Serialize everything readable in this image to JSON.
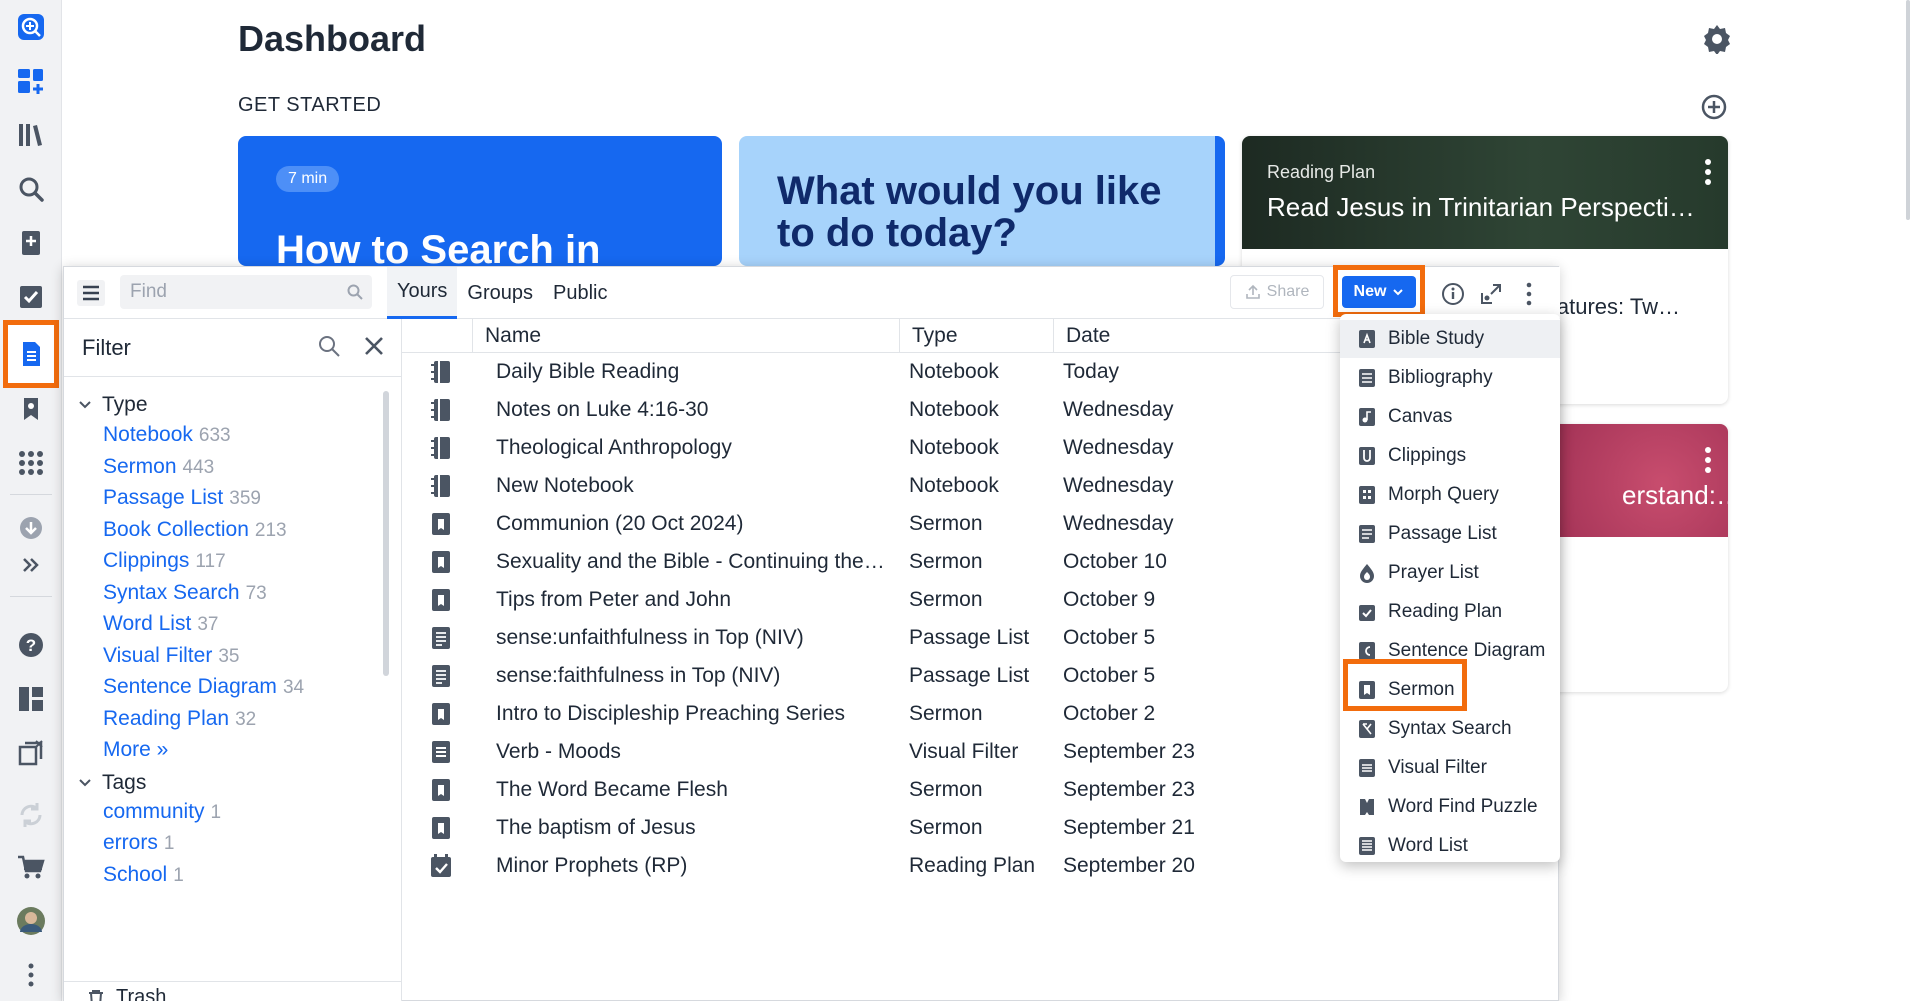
{
  "dashboard": {
    "title": "Dashboard",
    "get_started": "GET STARTED",
    "card1": {
      "badge": "7 min",
      "headline": "How to Search in"
    },
    "card2": {
      "headline": "What would you like to do today?"
    },
    "card3": {
      "kicker": "Reading Plan",
      "title": "Read Jesus in Trinitarian Perspecti…",
      "subtitle": "latures: Tw…"
    },
    "card4": {
      "title": "erstand:…"
    }
  },
  "toolbar": {
    "find_placeholder": "Find",
    "tabs": [
      "Yours",
      "Groups",
      "Public"
    ],
    "share_label": "Share",
    "new_label": "New"
  },
  "filter": {
    "title": "Filter",
    "type_heading": "Type",
    "types": [
      {
        "label": "Notebook",
        "count": "633"
      },
      {
        "label": "Sermon",
        "count": "443"
      },
      {
        "label": "Passage List",
        "count": "359"
      },
      {
        "label": "Book Collection",
        "count": "213"
      },
      {
        "label": "Clippings",
        "count": "117"
      },
      {
        "label": "Syntax Search",
        "count": "73"
      },
      {
        "label": "Word List",
        "count": "37"
      },
      {
        "label": "Visual Filter",
        "count": "35"
      },
      {
        "label": "Sentence Diagram",
        "count": "34"
      },
      {
        "label": "Reading Plan",
        "count": "32"
      }
    ],
    "more": "More »",
    "tags_heading": "Tags",
    "tags": [
      {
        "label": "community",
        "count": "1"
      },
      {
        "label": "errors",
        "count": "1"
      },
      {
        "label": "School",
        "count": "1"
      }
    ],
    "trash": "Trash"
  },
  "table": {
    "headers": {
      "name": "Name",
      "type": "Type",
      "date": "Date"
    },
    "rows": [
      {
        "icon": "notebook-icon",
        "name": "Daily Bible Reading",
        "type": "Notebook",
        "date": "Today"
      },
      {
        "icon": "notebook-icon",
        "name": "Notes on Luke 4:16-30",
        "type": "Notebook",
        "date": "Wednesday"
      },
      {
        "icon": "notebook-icon",
        "name": "Theological Anthropology",
        "type": "Notebook",
        "date": "Wednesday"
      },
      {
        "icon": "notebook-icon",
        "name": "New Notebook",
        "type": "Notebook",
        "date": "Wednesday"
      },
      {
        "icon": "sermon-icon",
        "name": "Communion (20 Oct 2024)",
        "type": "Sermon",
        "date": "Wednesday"
      },
      {
        "icon": "sermon-icon",
        "name": "Sexuality and the Bible - Continuing the…",
        "type": "Sermon",
        "date": "October 10"
      },
      {
        "icon": "sermon-icon",
        "name": "Tips from Peter and John",
        "type": "Sermon",
        "date": "October 9"
      },
      {
        "icon": "passage-list-icon",
        "name": "sense:unfaithfulness in Top (NIV)",
        "type": "Passage List",
        "date": "October 5"
      },
      {
        "icon": "passage-list-icon",
        "name": "sense:faithfulness in Top (NIV)",
        "type": "Passage List",
        "date": "October 5"
      },
      {
        "icon": "sermon-icon",
        "name": "Intro to Discipleship Preaching Series",
        "type": "Sermon",
        "date": "October 2"
      },
      {
        "icon": "visual-filter-icon",
        "name": "Verb - Moods",
        "type": "Visual Filter",
        "date": "September 23"
      },
      {
        "icon": "sermon-icon",
        "name": "The Word Became Flesh",
        "type": "Sermon",
        "date": "September 23"
      },
      {
        "icon": "sermon-icon",
        "name": "The baptism of Jesus",
        "type": "Sermon",
        "date": "September 21"
      },
      {
        "icon": "reading-plan-icon",
        "name": "Minor Prophets (RP)",
        "type": "Reading Plan",
        "date": "September 20"
      }
    ]
  },
  "new_menu": {
    "items": [
      {
        "label": "Bible Study",
        "icon": "bible-study-icon"
      },
      {
        "label": "Bibliography",
        "icon": "bibliography-icon"
      },
      {
        "label": "Canvas",
        "icon": "canvas-icon"
      },
      {
        "label": "Clippings",
        "icon": "clippings-icon"
      },
      {
        "label": "Morph Query",
        "icon": "morph-query-icon"
      },
      {
        "label": "Passage List",
        "icon": "passage-list-icon"
      },
      {
        "label": "Prayer List",
        "icon": "prayer-list-icon"
      },
      {
        "label": "Reading Plan",
        "icon": "reading-plan-icon"
      },
      {
        "label": "Sentence Diagram",
        "icon": "sentence-diagram-icon"
      },
      {
        "label": "Sermon",
        "icon": "sermon-icon"
      },
      {
        "label": "Syntax Search",
        "icon": "syntax-search-icon"
      },
      {
        "label": "Visual Filter",
        "icon": "visual-filter-icon"
      },
      {
        "label": "Word Find Puzzle",
        "icon": "word-find-puzzle-icon"
      },
      {
        "label": "Word List",
        "icon": "word-list-icon"
      }
    ]
  },
  "colors": {
    "accent": "#1668f0",
    "highlight": "#f26c0d",
    "icon": "#4b5563"
  }
}
